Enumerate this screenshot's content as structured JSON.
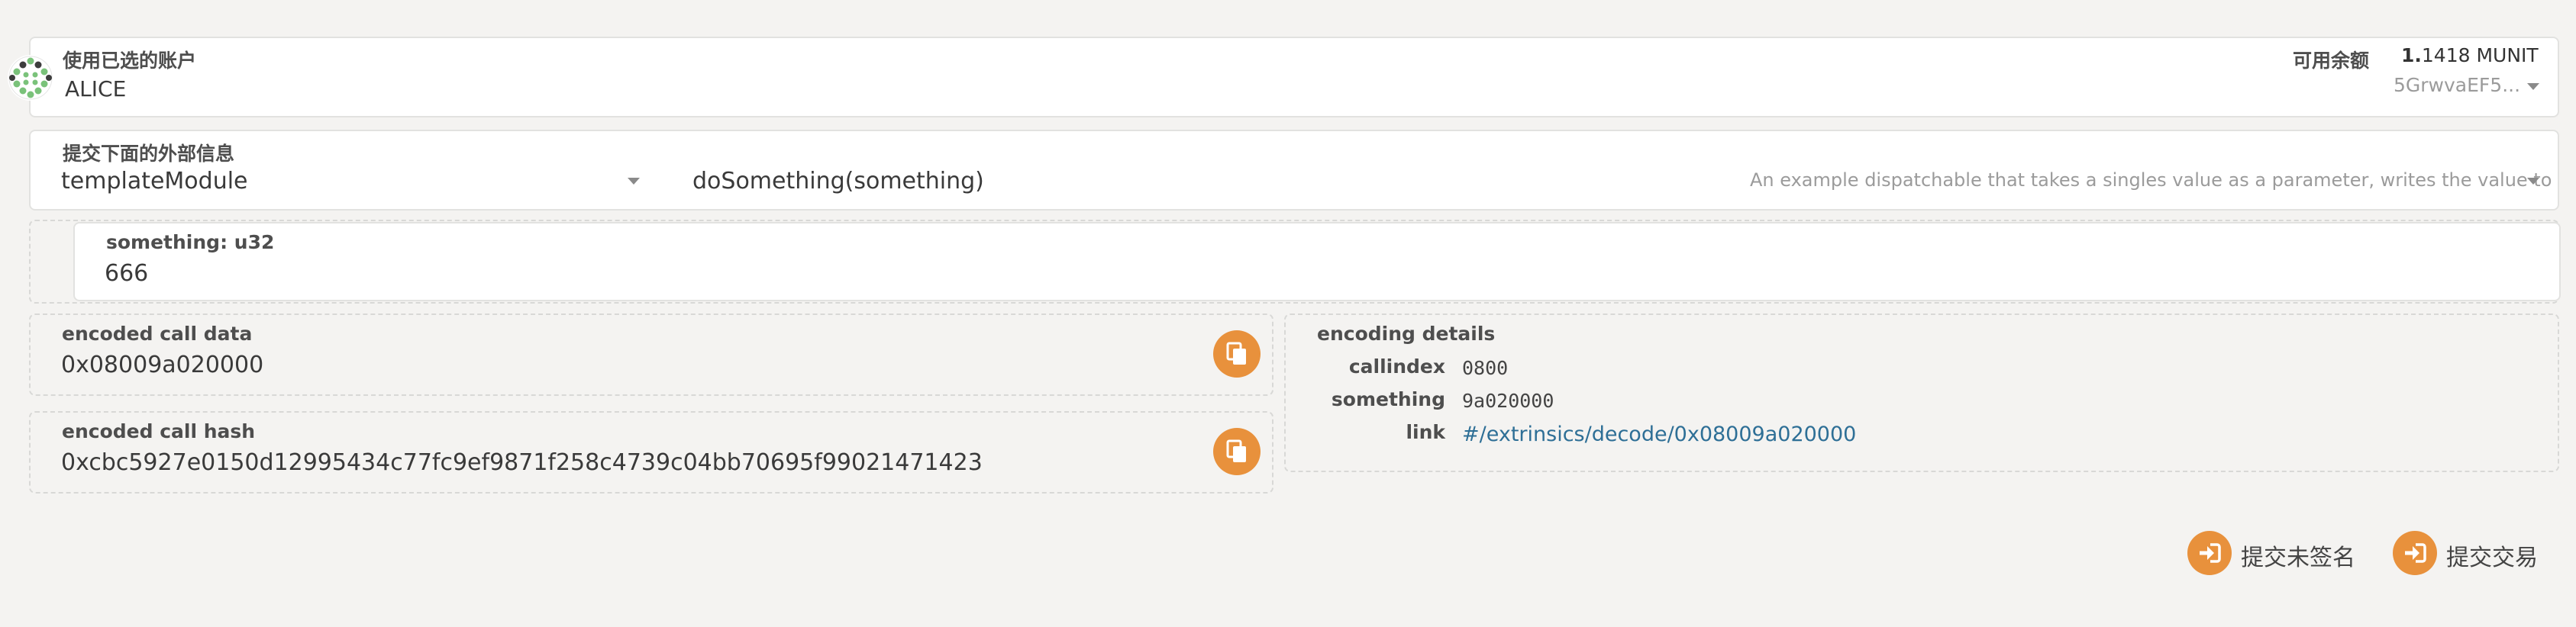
{
  "account": {
    "label": "使用已选的账户",
    "name": "ALICE",
    "balance_label": "可用余额",
    "balance_int": "1.",
    "balance_rest": "1418 MUNIT",
    "address": "5GrwvaEF5..."
  },
  "extrinsic": {
    "label": "提交下面的外部信息",
    "module": "templateModule",
    "method": "doSomething(something)",
    "doc": "An example dispatchable that takes a singles value as a parameter, writes the value to"
  },
  "param": {
    "label": "something: u32",
    "value": "666"
  },
  "encoded": {
    "call_data_label": "encoded call data",
    "call_data": "0x08009a020000",
    "call_hash_label": "encoded call hash",
    "call_hash": "0xcbc5927e0150d12995434c77fc9ef9871f258c4739c04bb70695f99021471423"
  },
  "details": {
    "title": "encoding details",
    "rows": [
      {
        "key": "callindex",
        "value": "0800"
      },
      {
        "key": "something",
        "value": "9a020000"
      },
      {
        "key": "link",
        "value": "#/extrinsics/decode/0x08009a020000"
      }
    ]
  },
  "actions": {
    "submit_unsigned": "提交未签名",
    "submit": "提交交易"
  },
  "colors": {
    "accent": "#e8913c",
    "link": "#2e6f96"
  }
}
